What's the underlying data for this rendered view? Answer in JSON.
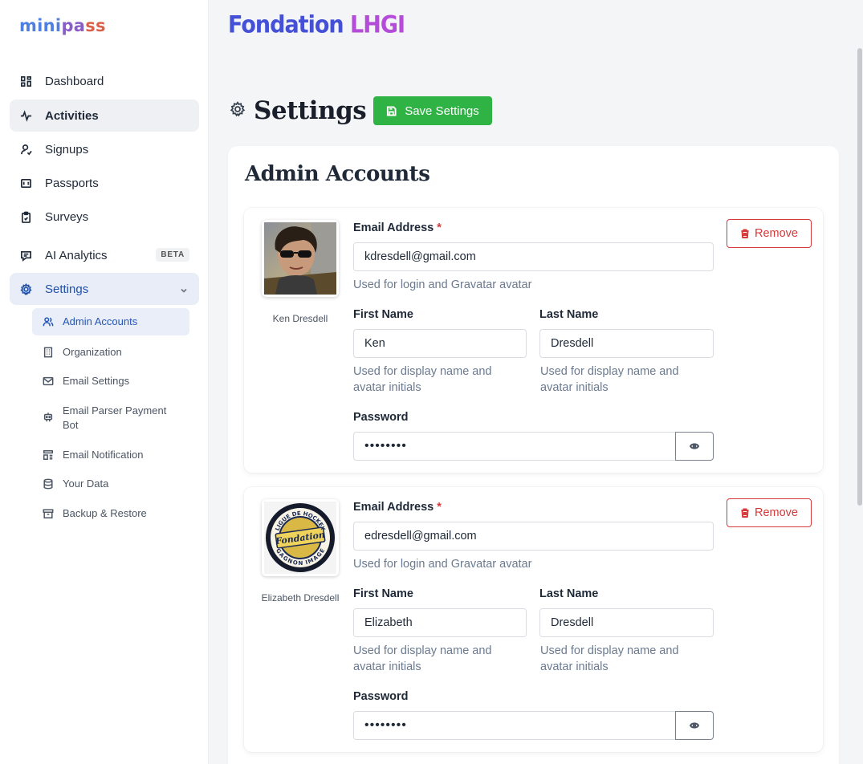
{
  "app": {
    "logo_part1": "mini",
    "logo_part2": "pa",
    "logo_part3": "ss",
    "org_name_part1": "Fondation",
    "org_name_part2": "LHGI"
  },
  "sidebar": {
    "items": [
      {
        "label": "Dashboard",
        "icon": "dashboard-icon"
      },
      {
        "label": "Activities",
        "icon": "activity-icon"
      },
      {
        "label": "Signups",
        "icon": "signups-icon"
      },
      {
        "label": "Passports",
        "icon": "passport-icon"
      },
      {
        "label": "Surveys",
        "icon": "clipboard-icon"
      },
      {
        "label": "AI Analytics",
        "icon": "chat-icon",
        "badge": "BETA"
      },
      {
        "label": "Settings",
        "icon": "gear-icon"
      }
    ],
    "sub_items": [
      {
        "label": "Admin Accounts",
        "icon": "users-icon"
      },
      {
        "label": "Organization",
        "icon": "building-icon"
      },
      {
        "label": "Email Settings",
        "icon": "mail-icon"
      },
      {
        "label": "Email Parser Payment Bot",
        "icon": "robot-icon"
      },
      {
        "label": "Email Notification",
        "icon": "template-icon"
      },
      {
        "label": "Your Data",
        "icon": "database-icon"
      },
      {
        "label": "Backup & Restore",
        "icon": "archive-icon"
      }
    ]
  },
  "page": {
    "title": "Settings",
    "save_label": "Save Settings",
    "section_title": "Admin Accounts"
  },
  "form_labels": {
    "email": "Email Address",
    "required_mark": "*",
    "email_hint": "Used for login and Gravatar avatar",
    "first_name": "First Name",
    "last_name": "Last Name",
    "name_hint": "Used for display name and avatar initials",
    "password": "Password",
    "remove": "Remove"
  },
  "accounts": [
    {
      "display_name": "Ken Dresdell",
      "email": "kdresdell@gmail.com",
      "first_name": "Ken",
      "last_name": "Dresdell",
      "password_mask": "••••••••"
    },
    {
      "display_name": "Elizabeth Dresdell",
      "email": "edresdell@gmail.com",
      "first_name": "Elizabeth",
      "last_name": "Dresdell",
      "password_mask": "••••••••"
    }
  ],
  "logo_badge": {
    "top": "LIGUE DE HOCKEY",
    "center": "Fondation",
    "bottom": "GAGNON IMAGE"
  },
  "colors": {
    "primary_green": "#2fb344",
    "danger_red": "#d63939",
    "accent_blue": "#2456b8"
  }
}
